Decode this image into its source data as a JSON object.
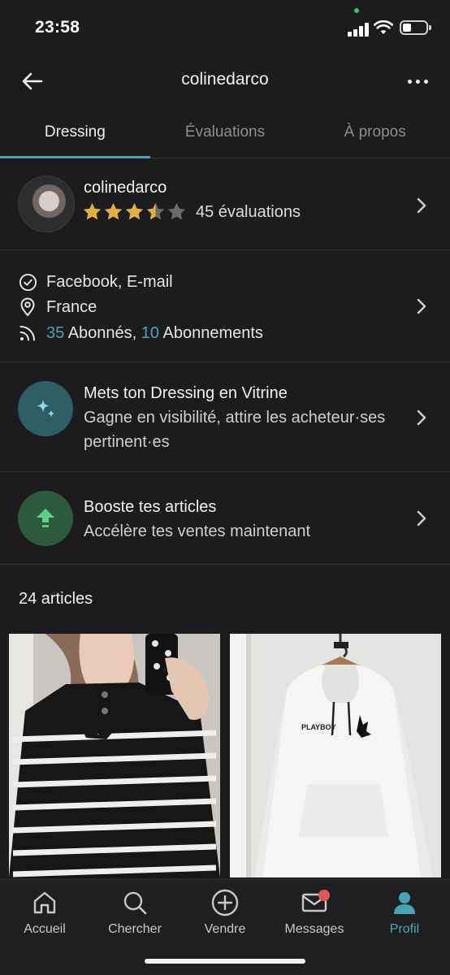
{
  "status_bar": {
    "time": "23:58"
  },
  "header": {
    "title": "colinedarco"
  },
  "tabs": [
    {
      "label": "Dressing",
      "active": true
    },
    {
      "label": "Évaluations",
      "active": false
    },
    {
      "label": "À propos",
      "active": false
    }
  ],
  "profile": {
    "username": "colinedarco",
    "rating": 3.5,
    "rating_max": 5,
    "ratings_label": "45 évaluations"
  },
  "info": {
    "verified": "Facebook, E-mail",
    "location": "France",
    "followers_count": "35",
    "followers_label": " Abonnés, ",
    "following_count": "10",
    "following_label": " Abonnements"
  },
  "vitrine": {
    "title": "Mets ton Dressing en Vitrine",
    "subtitle": "Gagne en visibilité, attire les acheteur·ses pertinent·es"
  },
  "boost": {
    "title": "Booste tes articles",
    "subtitle": "Accélère tes ventes maintenant"
  },
  "articles": {
    "count_label": "24 articles"
  },
  "tab_bar": [
    {
      "label": "Accueil",
      "icon": "home-icon"
    },
    {
      "label": "Chercher",
      "icon": "search-icon"
    },
    {
      "label": "Vendre",
      "icon": "plus-circle-icon"
    },
    {
      "label": "Messages",
      "icon": "mail-icon",
      "badge": true
    },
    {
      "label": "Profil",
      "icon": "user-icon",
      "active": true
    }
  ],
  "colors": {
    "accent": "#4aa3b3",
    "background": "#1c1c1e",
    "star": "#e2b13c",
    "vitrine_bg": "#2e5d63",
    "boost_bg": "#2e5a3c",
    "boost_icon": "#5fd08a",
    "badge": "#e0565d"
  }
}
